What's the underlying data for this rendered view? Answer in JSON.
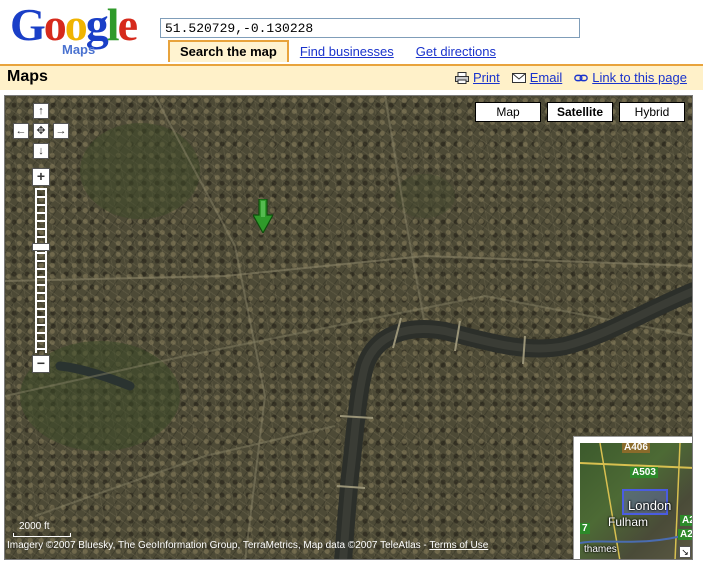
{
  "header": {
    "logo_text": "Google",
    "logo_sub": "Maps",
    "search_value": "51.520729,-0.130228",
    "tabs": {
      "active": "Search the map",
      "find_businesses": "Find businesses",
      "get_directions": "Get directions"
    }
  },
  "titlebar": {
    "title": "Maps",
    "print": "Print",
    "email": "Email",
    "link": "Link to this page"
  },
  "map": {
    "type_buttons": {
      "map": "Map",
      "satellite": "Satellite",
      "hybrid": "Hybrid"
    },
    "selected_type": "Satellite",
    "pan": {
      "up": "↑",
      "down": "↓",
      "left": "←",
      "right": "→",
      "center": "✥"
    },
    "zoom": {
      "plus": "+",
      "minus": "−",
      "level_fraction": 0.35
    },
    "scale_label": "2000 ft",
    "copyright_text": "Imagery ©2007 Bluesky, The GeoInformation Group, TerraMetrics, Map data ©2007 TeleAtlas - ",
    "terms_link": "Terms of Use",
    "overview": {
      "road_a406": "A406",
      "road_a503": "A503",
      "road_a2": "A2",
      "road_7": "7",
      "london": "London",
      "fulham": "Fulham",
      "thames": "thames",
      "resize": "↘"
    },
    "marker_color": "#2f9a2a"
  }
}
